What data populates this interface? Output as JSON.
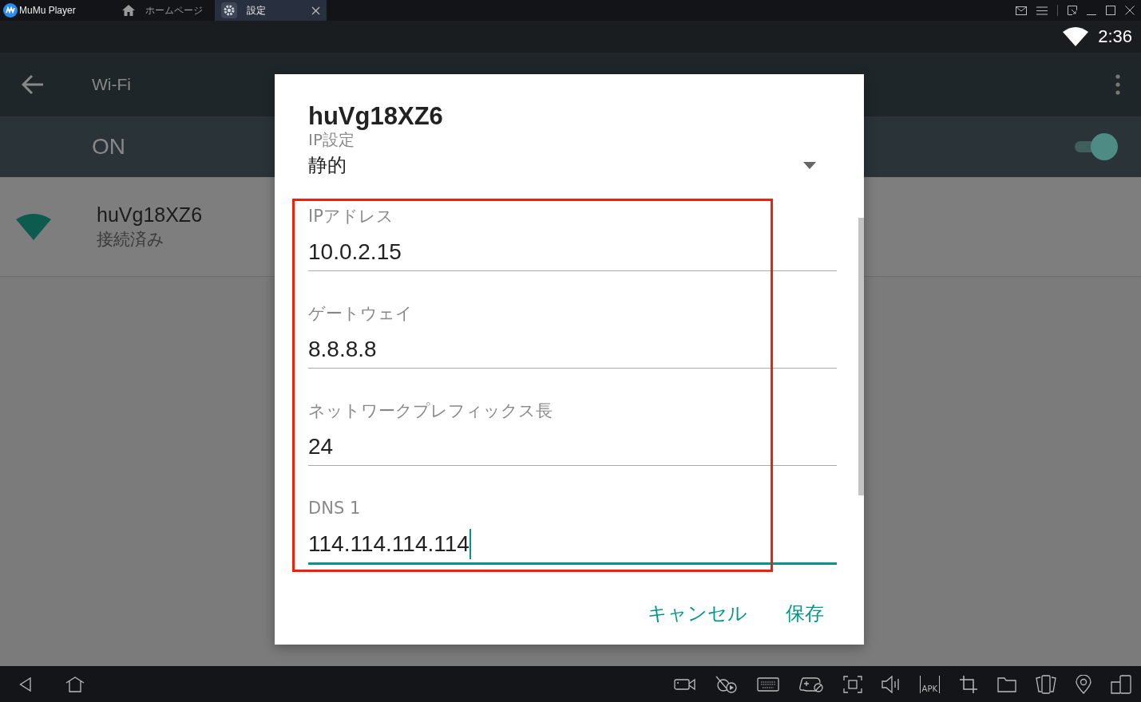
{
  "emulator_bar": {
    "app_name": "MuMu Player",
    "tabs": [
      {
        "label": "ホームページ",
        "selected": false,
        "closable": false
      },
      {
        "label": "設定",
        "selected": true,
        "closable": true
      }
    ]
  },
  "status_bar": {
    "time": "2:36"
  },
  "app_bar": {
    "title": "Wi-Fi"
  },
  "wifi_switch": {
    "label": "ON",
    "on": true
  },
  "networks": [
    {
      "name": "huVg18XZ6",
      "status": "接続済み"
    }
  ],
  "dialog": {
    "title": "huVg18XZ6",
    "ip_settings_label": "IP設定",
    "ip_settings_value": "静的",
    "fields": [
      {
        "label": "IPアドレス",
        "value": "10.0.2.15",
        "focused": false
      },
      {
        "label": "ゲートウェイ",
        "value": "8.8.8.8",
        "focused": false
      },
      {
        "label": "ネットワークプレフィックス長",
        "value": "24",
        "focused": false
      },
      {
        "label": "DNS 1",
        "value": "114.114.114.114",
        "focused": true
      }
    ],
    "buttons": [
      {
        "label": "キャンセル"
      },
      {
        "label": "保存"
      }
    ]
  },
  "toolbar": [
    {
      "kind": "camera"
    },
    {
      "kind": "no-video"
    },
    {
      "kind": "keyboard"
    },
    {
      "kind": "gamepad"
    },
    {
      "kind": "screenshot"
    },
    {
      "kind": "volume"
    },
    {
      "kind": "apk",
      "label": "APK"
    },
    {
      "kind": "crop"
    },
    {
      "kind": "folder"
    },
    {
      "kind": "rotate"
    },
    {
      "kind": "location"
    },
    {
      "kind": "multi"
    }
  ]
}
